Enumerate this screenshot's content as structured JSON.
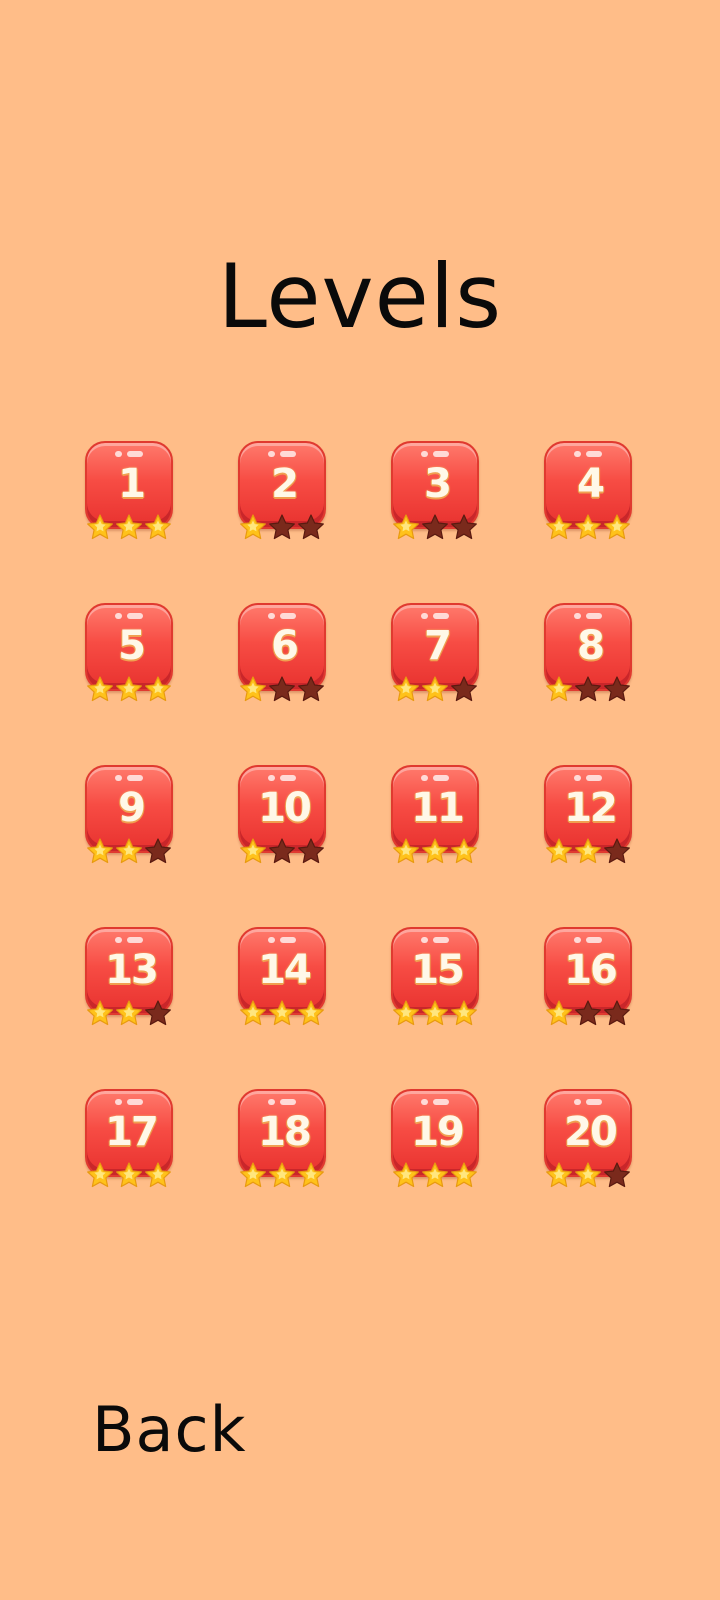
{
  "screen": {
    "title": "Levels",
    "back_label": "Back"
  },
  "colors": {
    "background": "#ffbd88",
    "tile": "#f74c44",
    "star_earned": "#ffc21a",
    "star_empty": "#7a2a1c"
  },
  "levels": [
    {
      "number": "1",
      "stars": 3
    },
    {
      "number": "2",
      "stars": 1
    },
    {
      "number": "3",
      "stars": 1
    },
    {
      "number": "4",
      "stars": 3
    },
    {
      "number": "5",
      "stars": 3
    },
    {
      "number": "6",
      "stars": 1
    },
    {
      "number": "7",
      "stars": 2
    },
    {
      "number": "8",
      "stars": 1
    },
    {
      "number": "9",
      "stars": 2
    },
    {
      "number": "10",
      "stars": 1
    },
    {
      "number": "11",
      "stars": 3
    },
    {
      "number": "12",
      "stars": 2
    },
    {
      "number": "13",
      "stars": 2
    },
    {
      "number": "14",
      "stars": 3
    },
    {
      "number": "15",
      "stars": 3
    },
    {
      "number": "16",
      "stars": 1
    },
    {
      "number": "17",
      "stars": 3
    },
    {
      "number": "18",
      "stars": 3
    },
    {
      "number": "19",
      "stars": 3
    },
    {
      "number": "20",
      "stars": 2
    }
  ]
}
